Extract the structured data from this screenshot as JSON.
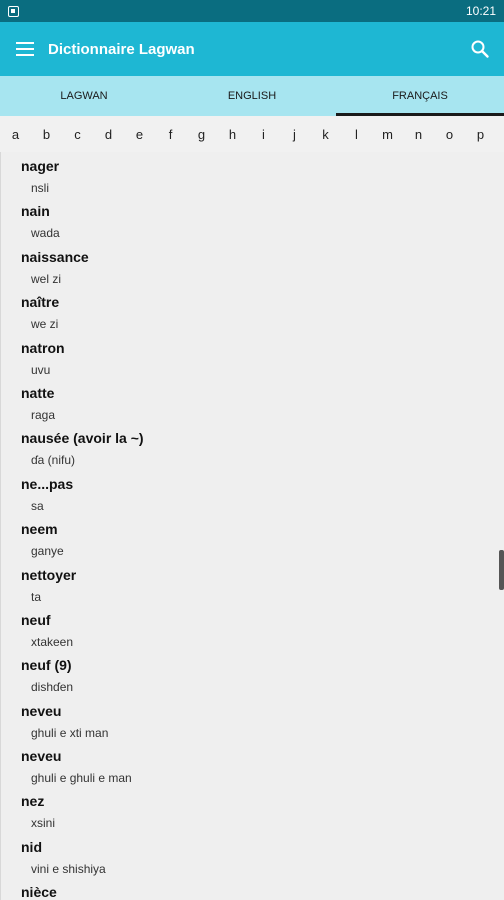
{
  "status_bar": {
    "time": "10:21"
  },
  "app_bar": {
    "title": "Dictionnaire Lagwan"
  },
  "tabs": [
    {
      "label": "LAGWAN",
      "active": false
    },
    {
      "label": "ENGLISH",
      "active": false
    },
    {
      "label": "FRANÇAIS",
      "active": true
    }
  ],
  "alphabet": [
    "a",
    "b",
    "c",
    "d",
    "e",
    "f",
    "g",
    "h",
    "i",
    "j",
    "k",
    "l",
    "m",
    "n",
    "o",
    "p"
  ],
  "entries": [
    {
      "word": "nager",
      "translation": "nsli"
    },
    {
      "word": "nain",
      "translation": "wada"
    },
    {
      "word": "naissance",
      "translation": "wel zi"
    },
    {
      "word": "naître",
      "translation": "we zi"
    },
    {
      "word": "natron",
      "translation": "uvu"
    },
    {
      "word": "natte",
      "translation": "raga"
    },
    {
      "word": "nausée (avoir la ~)",
      "translation": "ɗa (nifu)"
    },
    {
      "word": "ne...pas",
      "translation": "sa"
    },
    {
      "word": "neem",
      "translation": "ganye"
    },
    {
      "word": "nettoyer",
      "translation": "ta"
    },
    {
      "word": "neuf",
      "translation": "xtakeen"
    },
    {
      "word": "neuf (9)",
      "translation": "dishɗen"
    },
    {
      "word": "neveu",
      "translation": "ghuli e xti man"
    },
    {
      "word": "neveu",
      "translation": "ghuli e ghuli e man"
    },
    {
      "word": "nez",
      "translation": "xsini"
    },
    {
      "word": "nid",
      "translation": "vini e shishiya"
    },
    {
      "word": "nièce",
      "translation": ""
    }
  ],
  "colors": {
    "status_bar": "#0a6d80",
    "app_bar": "#1eb7d3",
    "tab_bar": "#a7e5f0",
    "background": "#efefef"
  },
  "icons": [
    "app-notification-icon",
    "menu-icon",
    "search-icon"
  ]
}
